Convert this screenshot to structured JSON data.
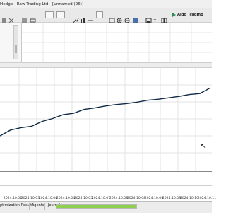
{
  "window": {
    "title": "Hedge - Raw Trading Ltd - [unnamed (26)]"
  },
  "toolbar": {
    "algo_trading_label": "Algo Trading",
    "icons": [
      "settings-icon",
      "close-icon",
      "list-icon",
      "toggle-icon",
      "chart-icon",
      "chart-icon",
      "cross-icon",
      "grid-icon",
      "chart-icon",
      "zoom-in-icon",
      "zoom-out-icon",
      "layout-icon",
      "grid-icon",
      "save-icon",
      "text-icon",
      "layout-icon",
      "grid-icon",
      "algo-play-icon"
    ]
  },
  "chart": {
    "type": "line",
    "series_color": "#0f2a44",
    "grid": true
  },
  "chart_data": {
    "type": "line",
    "title": "",
    "xlabel": "",
    "ylabel": "",
    "x": [
      0,
      5,
      10,
      15,
      20,
      25,
      30,
      35,
      40,
      45,
      50,
      55,
      60,
      65,
      70,
      75,
      80,
      85,
      90,
      95,
      100
    ],
    "y": [
      0.0,
      0.12,
      0.17,
      0.2,
      0.3,
      0.36,
      0.44,
      0.47,
      0.55,
      0.58,
      0.62,
      0.65,
      0.67,
      0.7,
      0.74,
      0.76,
      0.79,
      0.82,
      0.86,
      0.88,
      1.0
    ],
    "tick_labels": [
      "2024.10.02",
      "2024.10.03",
      "2024.10.04",
      "2024.10.04",
      "2024.10.05",
      "2024.10.07",
      "2024.10.08",
      "2024.10.08",
      "2024.10.09",
      "2024.10.09",
      "2024.10.10",
      "2024.10.11"
    ]
  },
  "bottom_tabs": {
    "optimization_results": "ptimization Results",
    "agents": "Agents",
    "journal": "Journal"
  },
  "progress": {
    "fraction": 1.0
  }
}
